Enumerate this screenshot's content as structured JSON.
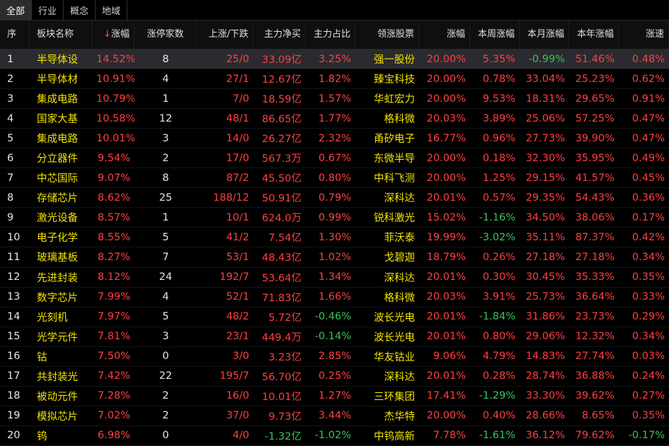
{
  "tabs": [
    {
      "label": "全部",
      "active": true
    },
    {
      "label": "行业",
      "active": false
    },
    {
      "label": "概念",
      "active": false
    },
    {
      "label": "地域",
      "active": false
    }
  ],
  "headers": [
    "序",
    "板块名称",
    "涨幅",
    "涨停家数",
    "上涨/下跌",
    "主力净买",
    "主力占比",
    "领涨股票",
    "涨幅",
    "本周涨幅",
    "本月涨幅",
    "本年涨幅",
    "涨速"
  ],
  "rows": [
    {
      "seq": "1",
      "name": "半导体设",
      "pct": "14.52%",
      "count": "8",
      "updown": "25/0",
      "net": "33.09亿",
      "ratio": "3.25%",
      "lead": "强一股份",
      "lpct": "20.00%",
      "week": "5.35%",
      "month": "-0.99%",
      "year": "51.46%",
      "speed": "0.48%"
    },
    {
      "seq": "2",
      "name": "半导体材",
      "pct": "10.91%",
      "count": "4",
      "updown": "27/1",
      "net": "12.67亿",
      "ratio": "1.82%",
      "lead": "臻宝科技",
      "lpct": "20.00%",
      "week": "0.78%",
      "month": "33.04%",
      "year": "25.23%",
      "speed": "0.62%"
    },
    {
      "seq": "3",
      "name": "集成电路",
      "pct": "10.79%",
      "count": "1",
      "updown": "7/0",
      "net": "18.59亿",
      "ratio": "1.57%",
      "lead": "华虹宏力",
      "lpct": "20.00%",
      "week": "9.53%",
      "month": "18.31%",
      "year": "29.65%",
      "speed": "0.91%"
    },
    {
      "seq": "4",
      "name": "国家大基",
      "pct": "10.58%",
      "count": "12",
      "updown": "48/1",
      "net": "86.65亿",
      "ratio": "1.77%",
      "lead": "格科微",
      "lpct": "20.03%",
      "week": "3.89%",
      "month": "25.06%",
      "year": "57.25%",
      "speed": "0.47%"
    },
    {
      "seq": "5",
      "name": "集成电路",
      "pct": "10.01%",
      "count": "3",
      "updown": "14/0",
      "net": "26.27亿",
      "ratio": "2.32%",
      "lead": "甬矽电子",
      "lpct": "16.77%",
      "week": "0.96%",
      "month": "27.73%",
      "year": "39.90%",
      "speed": "0.47%"
    },
    {
      "seq": "6",
      "name": "分立器件",
      "pct": "9.54%",
      "count": "2",
      "updown": "17/0",
      "net": "567.3万",
      "ratio": "0.67%",
      "lead": "东微半导",
      "lpct": "20.00%",
      "week": "0.18%",
      "month": "32.30%",
      "year": "35.95%",
      "speed": "0.49%"
    },
    {
      "seq": "7",
      "name": "中芯国际",
      "pct": "9.07%",
      "count": "8",
      "updown": "87/2",
      "net": "45.50亿",
      "ratio": "0.80%",
      "lead": "中科飞测",
      "lpct": "20.00%",
      "week": "1.25%",
      "month": "29.15%",
      "year": "41.57%",
      "speed": "0.45%"
    },
    {
      "seq": "8",
      "name": "存储芯片",
      "pct": "8.62%",
      "count": "25",
      "updown": "188/12",
      "net": "50.91亿",
      "ratio": "0.79%",
      "lead": "深科达",
      "lpct": "20.01%",
      "week": "0.57%",
      "month": "29.35%",
      "year": "54.43%",
      "speed": "0.36%"
    },
    {
      "seq": "9",
      "name": "激光设备",
      "pct": "8.57%",
      "count": "1",
      "updown": "10/1",
      "net": "624.0万",
      "ratio": "0.99%",
      "lead": "锐科激光",
      "lpct": "15.02%",
      "week": "-1.16%",
      "month": "34.50%",
      "year": "38.06%",
      "speed": "0.17%"
    },
    {
      "seq": "10",
      "name": "电子化学",
      "pct": "8.55%",
      "count": "5",
      "updown": "41/2",
      "net": "7.54亿",
      "ratio": "1.30%",
      "lead": "菲沃泰",
      "lpct": "19.99%",
      "week": "-3.02%",
      "month": "35.11%",
      "year": "87.37%",
      "speed": "0.42%"
    },
    {
      "seq": "11",
      "name": "玻璃基板",
      "pct": "8.27%",
      "count": "7",
      "updown": "53/1",
      "net": "48.43亿",
      "ratio": "1.02%",
      "lead": "戈碧迦",
      "lpct": "18.79%",
      "week": "0.26%",
      "month": "27.18%",
      "year": "27.18%",
      "speed": "0.34%"
    },
    {
      "seq": "12",
      "name": "先进封装",
      "pct": "8.12%",
      "count": "24",
      "updown": "192/7",
      "net": "53.64亿",
      "ratio": "1.34%",
      "lead": "深科达",
      "lpct": "20.01%",
      "week": "0.30%",
      "month": "30.45%",
      "year": "35.33%",
      "speed": "0.35%"
    },
    {
      "seq": "13",
      "name": "数字芯片",
      "pct": "7.99%",
      "count": "4",
      "updown": "52/1",
      "net": "71.83亿",
      "ratio": "1.66%",
      "lead": "格科微",
      "lpct": "20.03%",
      "week": "3.91%",
      "month": "25.73%",
      "year": "36.64%",
      "speed": "0.33%"
    },
    {
      "seq": "14",
      "name": "光刻机",
      "pct": "7.97%",
      "count": "5",
      "updown": "48/2",
      "net": "5.72亿",
      "ratio": "-0.46%",
      "lead": "波长光电",
      "lpct": "20.01%",
      "week": "-1.84%",
      "month": "31.86%",
      "year": "23.73%",
      "speed": "0.29%"
    },
    {
      "seq": "15",
      "name": "光学元件",
      "pct": "7.81%",
      "count": "3",
      "updown": "23/1",
      "net": "449.4万",
      "ratio": "-0.14%",
      "lead": "波长光电",
      "lpct": "20.01%",
      "week": "0.80%",
      "month": "29.06%",
      "year": "12.32%",
      "speed": "0.34%"
    },
    {
      "seq": "16",
      "name": "钴",
      "pct": "7.50%",
      "count": "0",
      "updown": "3/0",
      "net": "3.23亿",
      "ratio": "2.85%",
      "lead": "华友钴业",
      "lpct": "9.06%",
      "week": "4.79%",
      "month": "14.83%",
      "year": "27.74%",
      "speed": "0.03%"
    },
    {
      "seq": "17",
      "name": "共封装光",
      "pct": "7.42%",
      "count": "22",
      "updown": "195/7",
      "net": "56.70亿",
      "ratio": "0.25%",
      "lead": "深科达",
      "lpct": "20.01%",
      "week": "0.28%",
      "month": "28.74%",
      "year": "36.88%",
      "speed": "0.24%"
    },
    {
      "seq": "18",
      "name": "被动元件",
      "pct": "7.28%",
      "count": "2",
      "updown": "16/0",
      "net": "10.01亿",
      "ratio": "1.27%",
      "lead": "三环集团",
      "lpct": "17.41%",
      "week": "-1.29%",
      "month": "33.30%",
      "year": "39.62%",
      "speed": "0.27%"
    },
    {
      "seq": "19",
      "name": "模拟芯片",
      "pct": "7.02%",
      "count": "2",
      "updown": "37/0",
      "net": "9.73亿",
      "ratio": "3.44%",
      "lead": "杰华特",
      "lpct": "20.00%",
      "week": "0.40%",
      "month": "28.66%",
      "year": "8.65%",
      "speed": "0.35%"
    },
    {
      "seq": "20",
      "name": "钨",
      "pct": "6.98%",
      "count": "0",
      "updown": "4/0",
      "net": "-1.32亿",
      "ratio": "-1.02%",
      "lead": "中钨高新",
      "lpct": "7.78%",
      "week": "-1.61%",
      "month": "36.12%",
      "year": "79.62%",
      "speed": "-0.17%"
    }
  ],
  "colors": {
    "up": "#ff4040",
    "down": "#39c55a",
    "name": "#f2e300",
    "header_bg": "#0f0f0f",
    "selected_row": "#2a2a30"
  }
}
